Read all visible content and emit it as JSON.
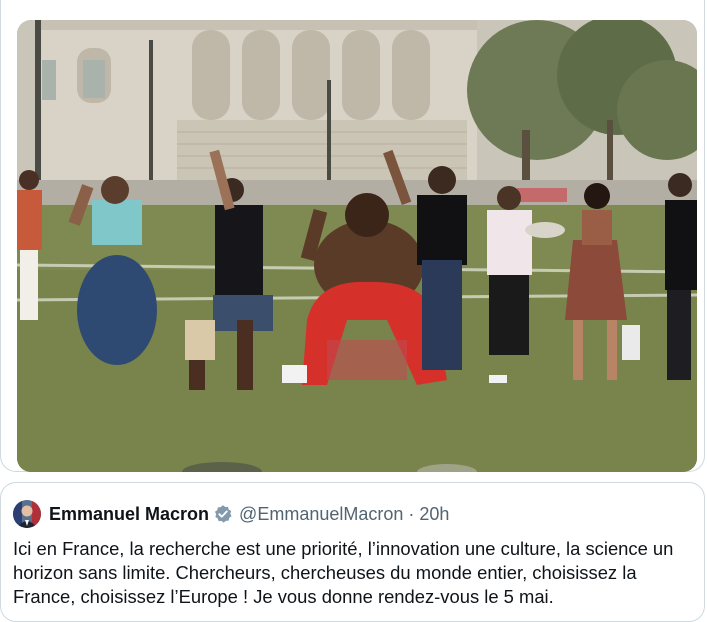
{
  "tweet": {
    "author": {
      "display_name": "Emmanuel Macron",
      "handle": "@EmmanuelMacron",
      "verified": true,
      "avatar_icon": "avatar-portrait"
    },
    "separator": "·",
    "time": "20h",
    "text": "Ici en France, la recherche est une priorité, l’innovation une culture, la science un horizon sans limite. Chercheurs, chercheuses du monde entier, choisissez la France, choisissez l’Europe ! Je vous donne rendez-vous le 5 mai."
  },
  "media": {
    "icon": "group-photo"
  },
  "colors": {
    "text_primary": "#0f1419",
    "text_secondary": "#536471",
    "border": "#cfd9de",
    "verified_badge": "#829aab"
  }
}
